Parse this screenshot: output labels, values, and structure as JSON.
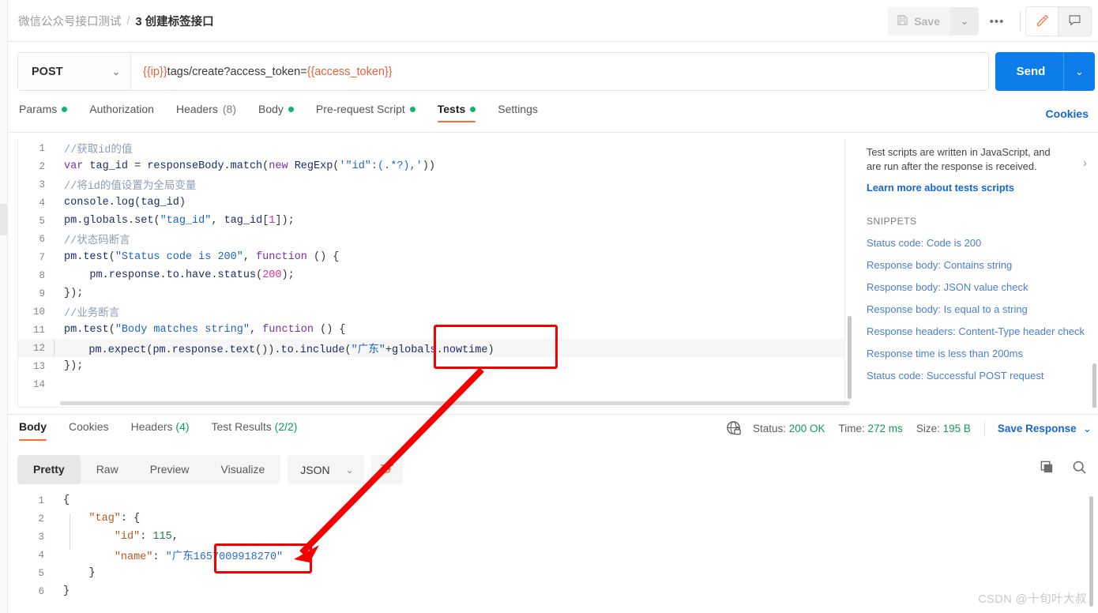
{
  "header": {
    "collection": "微信公众号接口测试",
    "separator": "/",
    "request_name": "3 创建标签接口",
    "save_label": "Save",
    "save_caret": "⌄",
    "more_label": "•••",
    "edit_icon": "pencil-icon",
    "comment_icon": "comment-icon"
  },
  "request": {
    "method": "POST",
    "method_caret": "⌄",
    "url_prefix_var": "{{ip}}",
    "url_mid": "tags/create?access_token=",
    "url_suffix_var": "{{access_token}}",
    "send_label": "Send",
    "send_caret": "⌄"
  },
  "request_tabs": [
    {
      "label": "Params",
      "dot": true,
      "count": "",
      "active": false
    },
    {
      "label": "Authorization",
      "dot": false,
      "count": "",
      "active": false
    },
    {
      "label": "Headers",
      "dot": false,
      "count": "(8)",
      "active": false
    },
    {
      "label": "Body",
      "dot": true,
      "count": "",
      "active": false
    },
    {
      "label": "Pre-request Script",
      "dot": true,
      "count": "",
      "active": false
    },
    {
      "label": "Tests",
      "dot": true,
      "count": "",
      "active": true
    },
    {
      "label": "Settings",
      "dot": false,
      "count": "",
      "active": false
    }
  ],
  "cookies_link": "Cookies",
  "code_lines": [
    {
      "n": "1",
      "segs": [
        {
          "t": "//获取id的值",
          "c": "cm-com"
        }
      ]
    },
    {
      "n": "2",
      "segs": [
        {
          "t": "var ",
          "c": "cm-kw"
        },
        {
          "t": "tag_id ",
          "c": "cm-var"
        },
        {
          "t": "= ",
          "c": "cm-punc"
        },
        {
          "t": "responseBody",
          "c": "cm-var"
        },
        {
          "t": ".",
          "c": "cm-punc"
        },
        {
          "t": "match",
          "c": "cm-plain"
        },
        {
          "t": "(",
          "c": "cm-punc"
        },
        {
          "t": "new ",
          "c": "cm-kw"
        },
        {
          "t": "RegExp",
          "c": "cm-plain"
        },
        {
          "t": "(",
          "c": "cm-punc"
        },
        {
          "t": "'\"id\":(.*?),'",
          "c": "cm-str"
        },
        {
          "t": "))",
          "c": "cm-punc"
        }
      ]
    },
    {
      "n": "3",
      "segs": [
        {
          "t": "//将id的值设置为全局变量",
          "c": "cm-com"
        }
      ]
    },
    {
      "n": "4",
      "segs": [
        {
          "t": "console",
          "c": "cm-var"
        },
        {
          "t": ".",
          "c": "cm-punc"
        },
        {
          "t": "log",
          "c": "cm-plain"
        },
        {
          "t": "(",
          "c": "cm-punc"
        },
        {
          "t": "tag_id",
          "c": "cm-var"
        },
        {
          "t": ")",
          "c": "cm-punc"
        }
      ]
    },
    {
      "n": "5",
      "segs": [
        {
          "t": "pm",
          "c": "cm-var"
        },
        {
          "t": ".",
          "c": "cm-punc"
        },
        {
          "t": "globals",
          "c": "cm-var"
        },
        {
          "t": ".",
          "c": "cm-punc"
        },
        {
          "t": "set",
          "c": "cm-plain"
        },
        {
          "t": "(",
          "c": "cm-punc"
        },
        {
          "t": "\"tag_id\"",
          "c": "cm-str"
        },
        {
          "t": ", ",
          "c": "cm-punc"
        },
        {
          "t": "tag_id",
          "c": "cm-var"
        },
        {
          "t": "[",
          "c": "cm-punc"
        },
        {
          "t": "1",
          "c": "cm-num"
        },
        {
          "t": "]);",
          "c": "cm-punc"
        }
      ]
    },
    {
      "n": "6",
      "segs": [
        {
          "t": "//状态码断言",
          "c": "cm-com"
        }
      ]
    },
    {
      "n": "7",
      "segs": [
        {
          "t": "pm",
          "c": "cm-var"
        },
        {
          "t": ".",
          "c": "cm-punc"
        },
        {
          "t": "test",
          "c": "cm-plain"
        },
        {
          "t": "(",
          "c": "cm-punc"
        },
        {
          "t": "\"Status code is 200\"",
          "c": "cm-str"
        },
        {
          "t": ", ",
          "c": "cm-punc"
        },
        {
          "t": "function ",
          "c": "cm-kw"
        },
        {
          "t": "() {",
          "c": "cm-punc"
        }
      ]
    },
    {
      "n": "8",
      "segs": [
        {
          "t": "    pm",
          "c": "cm-var"
        },
        {
          "t": ".",
          "c": "cm-punc"
        },
        {
          "t": "response",
          "c": "cm-var"
        },
        {
          "t": ".",
          "c": "cm-punc"
        },
        {
          "t": "to",
          "c": "cm-var"
        },
        {
          "t": ".",
          "c": "cm-punc"
        },
        {
          "t": "have",
          "c": "cm-var"
        },
        {
          "t": ".",
          "c": "cm-punc"
        },
        {
          "t": "status",
          "c": "cm-plain"
        },
        {
          "t": "(",
          "c": "cm-punc"
        },
        {
          "t": "200",
          "c": "cm-num"
        },
        {
          "t": ");",
          "c": "cm-punc"
        }
      ]
    },
    {
      "n": "9",
      "segs": [
        {
          "t": "});",
          "c": "cm-punc"
        }
      ]
    },
    {
      "n": "10",
      "segs": [
        {
          "t": "//业务断言",
          "c": "cm-com"
        }
      ]
    },
    {
      "n": "11",
      "segs": [
        {
          "t": "pm",
          "c": "cm-var"
        },
        {
          "t": ".",
          "c": "cm-punc"
        },
        {
          "t": "test",
          "c": "cm-plain"
        },
        {
          "t": "(",
          "c": "cm-punc"
        },
        {
          "t": "\"Body matches string\"",
          "c": "cm-str"
        },
        {
          "t": ", ",
          "c": "cm-punc"
        },
        {
          "t": "function ",
          "c": "cm-kw"
        },
        {
          "t": "() {",
          "c": "cm-punc"
        }
      ]
    },
    {
      "n": "12",
      "segs": [
        {
          "t": "    pm",
          "c": "cm-var"
        },
        {
          "t": ".",
          "c": "cm-punc"
        },
        {
          "t": "expect",
          "c": "cm-plain"
        },
        {
          "t": "(",
          "c": "cm-punc"
        },
        {
          "t": "pm",
          "c": "cm-var"
        },
        {
          "t": ".",
          "c": "cm-punc"
        },
        {
          "t": "response",
          "c": "cm-var"
        },
        {
          "t": ".",
          "c": "cm-punc"
        },
        {
          "t": "text",
          "c": "cm-plain"
        },
        {
          "t": "()).",
          "c": "cm-punc"
        },
        {
          "t": "to",
          "c": "cm-var"
        },
        {
          "t": ".",
          "c": "cm-punc"
        },
        {
          "t": "include",
          "c": "cm-plain"
        },
        {
          "t": "(",
          "c": "cm-punc"
        },
        {
          "t": "\"广东\"",
          "c": "cm-str"
        },
        {
          "t": "+",
          "c": "cm-punc"
        },
        {
          "t": "globals",
          "c": "cm-var"
        },
        {
          "t": ".",
          "c": "cm-punc"
        },
        {
          "t": "nowtime",
          "c": "cm-var"
        },
        {
          "t": ")",
          "c": "cm-punc"
        }
      ]
    },
    {
      "n": "13",
      "segs": [
        {
          "t": "});",
          "c": "cm-punc"
        }
      ]
    },
    {
      "n": "14",
      "segs": [
        {
          "t": "",
          "c": "cm-punc"
        }
      ]
    }
  ],
  "snippets_panel": {
    "description": "Test scripts are written in JavaScript, and are run after the response is received.",
    "chevron": "›",
    "learn_more": "Learn more about tests scripts",
    "section_title": "SNIPPETS",
    "items": [
      "Status code: Code is 200",
      "Response body: Contains string",
      "Response body: JSON value check",
      "Response body: Is equal to a string",
      "Response headers: Content-Type header check",
      "Response time is less than 200ms",
      "Status code: Successful POST request"
    ]
  },
  "response_tabs": [
    {
      "label": "Body",
      "count": "",
      "active": true
    },
    {
      "label": "Cookies",
      "count": "",
      "active": false
    },
    {
      "label": "Headers",
      "count": "(4)",
      "active": false
    },
    {
      "label": "Test Results",
      "count": "(2/2)",
      "active": false
    }
  ],
  "response_meta": {
    "globe_icon": "globe-lock-icon",
    "status_label": "Status:",
    "status_value": "200 OK",
    "time_label": "Time:",
    "time_value": "272 ms",
    "size_label": "Size:",
    "size_value": "195 B",
    "save_response": "Save Response",
    "save_response_caret": "⌄"
  },
  "body_toolbar": {
    "views": [
      "Pretty",
      "Raw",
      "Preview",
      "Visualize"
    ],
    "active_view": "Pretty",
    "format": "JSON",
    "format_caret": "⌄",
    "wrap_icon": "word-wrap-icon",
    "copy_icon": "copy-icon",
    "search_icon": "search-icon"
  },
  "response_body_lines": [
    {
      "n": "1",
      "segs": [
        {
          "t": "{",
          "c": "j-brace"
        }
      ]
    },
    {
      "n": "2",
      "segs": [
        {
          "t": "    ",
          "c": "j-brace"
        },
        {
          "t": "\"tag\"",
          "c": "j-key"
        },
        {
          "t": ": {",
          "c": "j-brace"
        }
      ]
    },
    {
      "n": "3",
      "segs": [
        {
          "t": "        ",
          "c": "j-brace"
        },
        {
          "t": "\"id\"",
          "c": "j-key"
        },
        {
          "t": ": ",
          "c": "j-brace"
        },
        {
          "t": "115",
          "c": "j-num"
        },
        {
          "t": ",",
          "c": "j-brace"
        }
      ]
    },
    {
      "n": "4",
      "segs": [
        {
          "t": "        ",
          "c": "j-brace"
        },
        {
          "t": "\"name\"",
          "c": "j-key"
        },
        {
          "t": ": ",
          "c": "j-brace"
        },
        {
          "t": "\"广东1657009918270\"",
          "c": "j-str"
        }
      ]
    },
    {
      "n": "5",
      "segs": [
        {
          "t": "    }",
          "c": "j-brace"
        }
      ]
    },
    {
      "n": "6",
      "segs": [
        {
          "t": "}",
          "c": "j-brace"
        }
      ]
    }
  ],
  "annotations": {
    "box1_target": "+globals.nowtime)",
    "box2_target": "1657009918270",
    "arrow_color": "#f40000"
  },
  "watermark": "CSDN @十旬叶大叔",
  "colors": {
    "accent_orange": "#ff6c37",
    "send_blue": "#0d7dea",
    "link_blue": "#1666d4",
    "green": "#0f9d58",
    "annotation_red": "#f40000"
  }
}
